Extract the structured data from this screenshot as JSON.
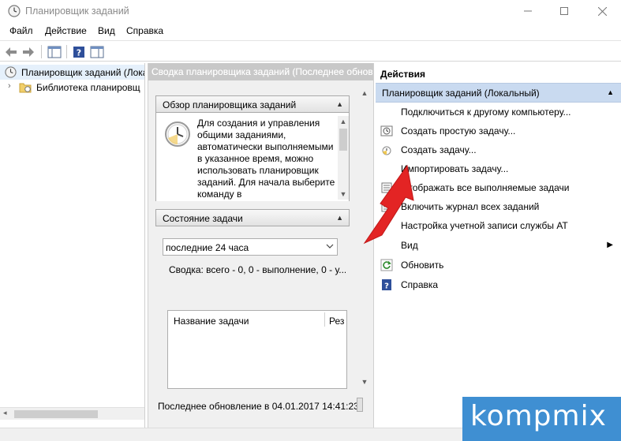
{
  "window": {
    "title": "Планировщик заданий"
  },
  "menu": {
    "file": "Файл",
    "action": "Действие",
    "view": "Вид",
    "help": "Справка"
  },
  "tree": {
    "root": "Планировщик заданий (Лока",
    "library": "Библиотека планировщ"
  },
  "center": {
    "header": "Сводка планировщика заданий (Последнее обнов",
    "overview": {
      "title": "Обзор планировщика заданий",
      "text": "Для создания и управления общими заданиями, автоматически выполняемыми в указанное время, можно использовать планировщик заданий. Для начала выберите команду в"
    },
    "status": {
      "title": "Состояние задачи",
      "period": "последние 24 часа",
      "summary": "Сводка: всего - 0, 0 - выполнение, 0 - у...",
      "col_name": "Название задачи",
      "col_result": "Рез"
    },
    "footer": "Последнее обновление в 04.01.2017 14:41:23"
  },
  "actions": {
    "header": "Действия",
    "group": "Планировщик заданий (Локальный)",
    "items": [
      {
        "label": "Подключиться к другому компьютеру...",
        "icon": "none"
      },
      {
        "label": "Создать простую задачу...",
        "icon": "wizard-icon"
      },
      {
        "label": "Создать задачу...",
        "icon": "task-clock-icon"
      },
      {
        "label": "Импортировать задачу...",
        "icon": "none"
      },
      {
        "label": "Отображать все выполняемые задачи",
        "icon": "list-icon"
      },
      {
        "label": "Включить журнал всех заданий",
        "icon": "log-icon"
      },
      {
        "label": "Настройка учетной записи службы AT",
        "icon": "none"
      },
      {
        "label": "Вид",
        "icon": "none"
      },
      {
        "label": "Обновить",
        "icon": "refresh-icon"
      },
      {
        "label": "Справка",
        "icon": "help-icon"
      }
    ]
  },
  "watermark": {
    "brand": "kompmix"
  },
  "colors": {
    "accent": "#3f8fd2",
    "selection": "#c9daf0",
    "arrow": "#e02020"
  }
}
